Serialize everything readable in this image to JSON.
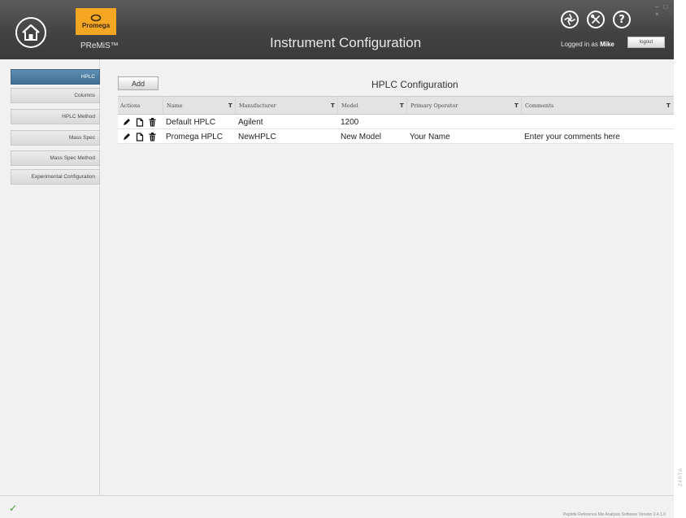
{
  "header": {
    "logo_text": "Promega",
    "app_name": "PReMiS™",
    "title": "Instrument Configuration",
    "logged_in_prefix": "Logged in as",
    "user_name": "Mike",
    "logout_label": "logout",
    "window_controls": "– □ ×",
    "icons": [
      "home-icon",
      "instrument-icon",
      "tools-icon",
      "help-icon"
    ]
  },
  "sidebar": {
    "items": [
      {
        "label": "HPLC",
        "active": true
      },
      {
        "label": "Columns",
        "active": false
      },
      {
        "label": "HPLC Method",
        "active": false
      },
      {
        "label": "Mass Spec",
        "active": false
      },
      {
        "label": "Mass Spec Method",
        "active": false
      },
      {
        "label": "Experimental Configuration",
        "active": false
      }
    ]
  },
  "main": {
    "add_label": "Add",
    "title": "HPLC Configuration",
    "columns": [
      "Actions",
      "Name",
      "Manufacturer",
      "Model",
      "Primary Operator",
      "Comments"
    ],
    "filter_glyph": "T",
    "rows": [
      {
        "name": "Default HPLC",
        "manufacturer": "Agilent",
        "model": "1200",
        "operator": "",
        "comments": ""
      },
      {
        "name": "Promega HPLC",
        "manufacturer": "NewHPLC",
        "model": "New Model",
        "operator": "Your Name",
        "comments": "Enter your comments here"
      }
    ],
    "row_action_icons": [
      "edit-icon",
      "copy-icon",
      "delete-icon"
    ]
  },
  "status_bar": {
    "status_icon": "check-icon",
    "version_text": "Peptide Reference Mix Analysis Software Version 0.4.1.0",
    "side_code": "24RTA"
  },
  "colors": {
    "header_bg": "#434343",
    "logo": "#f5a623",
    "active_nav": "#4a7aa0",
    "status_ok": "#3e9d2c"
  }
}
